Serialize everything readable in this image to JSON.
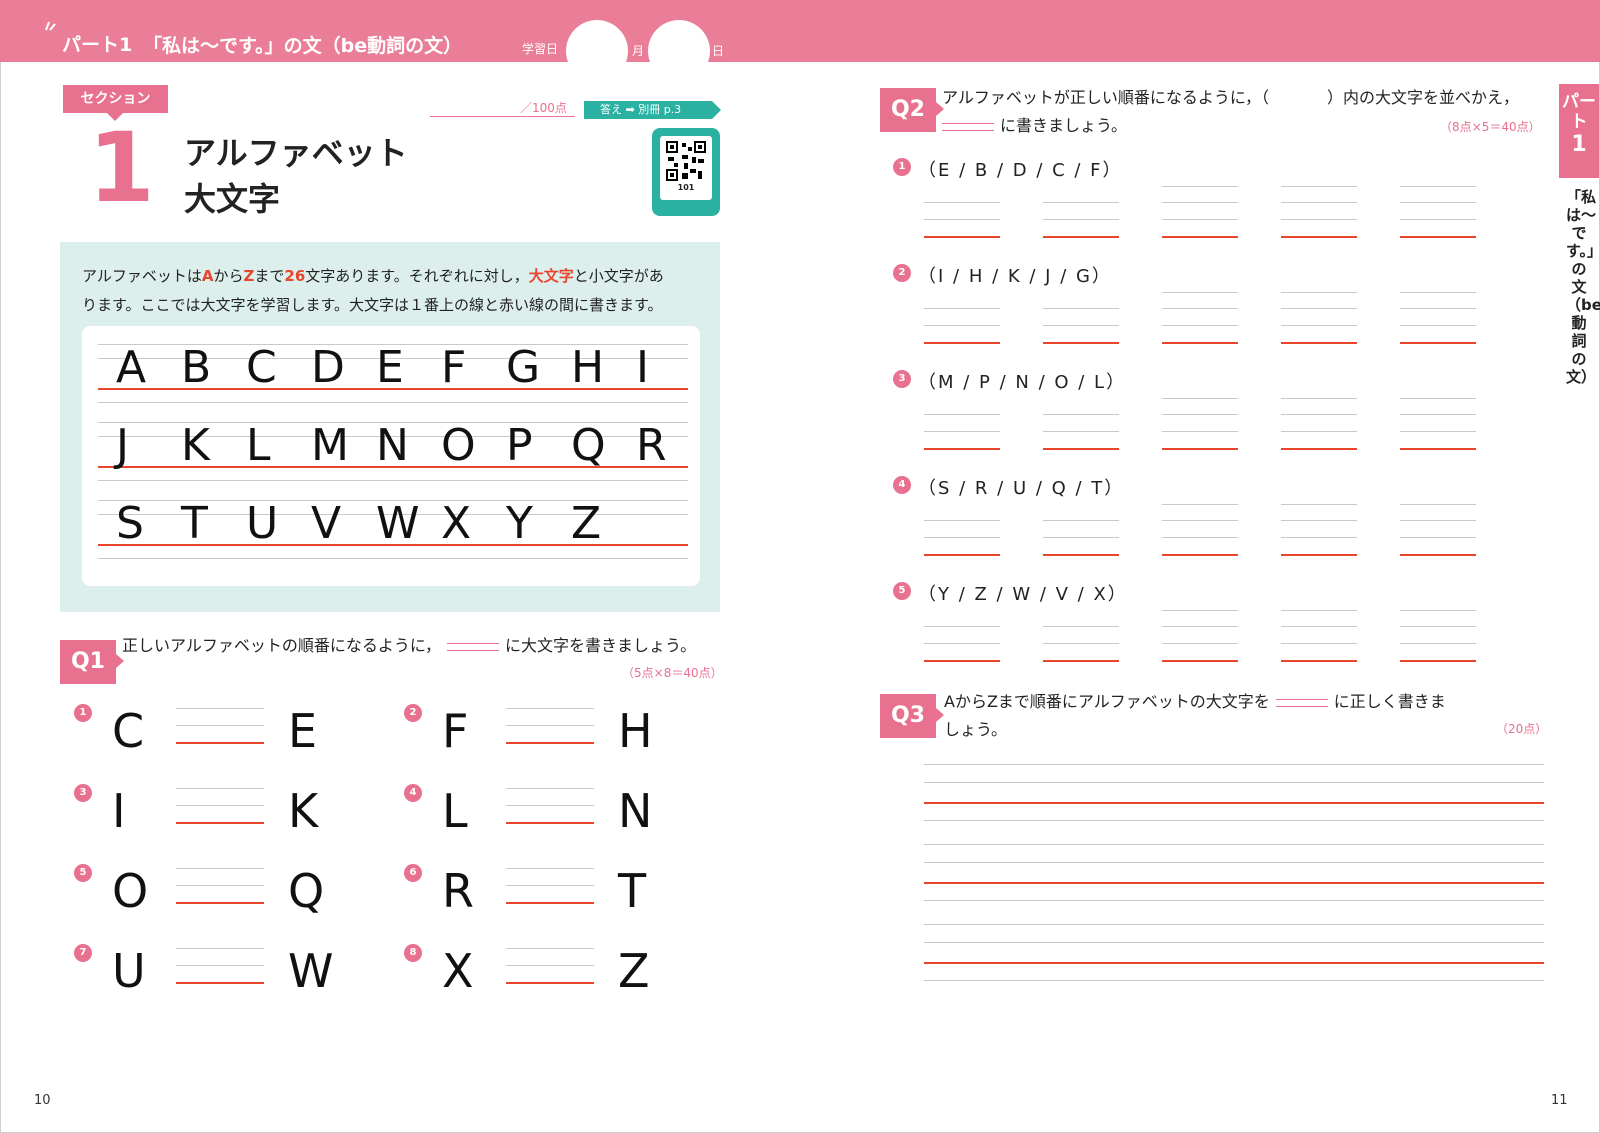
{
  "header": {
    "part_label": "パート1",
    "part_title": "「私は〜です。」の文（be動詞の文）",
    "study_date_label": "学習日",
    "month_label": "月",
    "day_label": "日"
  },
  "section": {
    "badge": "セクション",
    "number": "1",
    "title_line1": "アルファベット",
    "title_line2": "大文字",
    "score": "／100点",
    "answer_ref": "答え ➡ 別冊 p.3",
    "qr_number": "101"
  },
  "info": {
    "line1_a": "アルファベットは",
    "line1_A": "A",
    "line1_b": "から",
    "line1_Z": "Z",
    "line1_c": "まで",
    "line1_26": "26",
    "line1_d": "文字あります。それぞれに対し，",
    "line1_upper": "大文字",
    "line1_e": "と小文字があ",
    "line2": "ります。ここでは大文字を学習します。大文字は１番上の線と赤い線の間に書きます。",
    "rows": [
      [
        "A",
        "B",
        "C",
        "D",
        "E",
        "F",
        "G",
        "H",
        "I"
      ],
      [
        "J",
        "K",
        "L",
        "M",
        "N",
        "O",
        "P",
        "Q",
        "R"
      ],
      [
        "S",
        "T",
        "U",
        "V",
        "W",
        "X",
        "Y",
        "Z"
      ]
    ]
  },
  "q1": {
    "label": "Q1",
    "text_a": "正しいアルファベットの順番になるように，",
    "text_b": "に大文字を書きましょう。",
    "points": "（5点×8＝40点）",
    "items": [
      {
        "num": "1",
        "left": "C",
        "right": "E"
      },
      {
        "num": "2",
        "left": "F",
        "right": "H"
      },
      {
        "num": "3",
        "left": "I",
        "right": "K"
      },
      {
        "num": "4",
        "left": "L",
        "right": "N"
      },
      {
        "num": "5",
        "left": "O",
        "right": "Q"
      },
      {
        "num": "6",
        "left": "R",
        "right": "T"
      },
      {
        "num": "7",
        "left": "U",
        "right": "W"
      },
      {
        "num": "8",
        "left": "X",
        "right": "Z"
      }
    ]
  },
  "q2": {
    "label": "Q2",
    "text_a": "アルファベットが正しい順番になるように，（",
    "text_b": "）内の大文字を並べかえ，",
    "text_c": "に書きましょう。",
    "points": "（8点×5＝40点）",
    "items": [
      {
        "num": "1",
        "seq": "（E / B / D / C / F）"
      },
      {
        "num": "2",
        "seq": "（I / H / K / J / G）"
      },
      {
        "num": "3",
        "seq": "（M / P / N / O / L）"
      },
      {
        "num": "4",
        "seq": "（S / R / U / Q / T）"
      },
      {
        "num": "5",
        "seq": "（Y / Z / W / V / X）"
      }
    ]
  },
  "q3": {
    "label": "Q3",
    "text_a": "AからZまで順番にアルファベットの大文字を",
    "text_b": "に正しく書きま",
    "text_c": "しょう。",
    "points": "（20点）"
  },
  "side": {
    "tab_line1": "パー",
    "tab_line2": "ト",
    "tab_line3": "1",
    "title": "「私は〜です。」の文（be動詞の文）"
  },
  "page_left": "10",
  "page_right": "11",
  "colors": {
    "accent_pink": "#e8718f",
    "header_pink": "#ea7e98",
    "red_line": "#e8452c",
    "teal": "#2bb1a2",
    "info_bg": "#dcefec"
  }
}
